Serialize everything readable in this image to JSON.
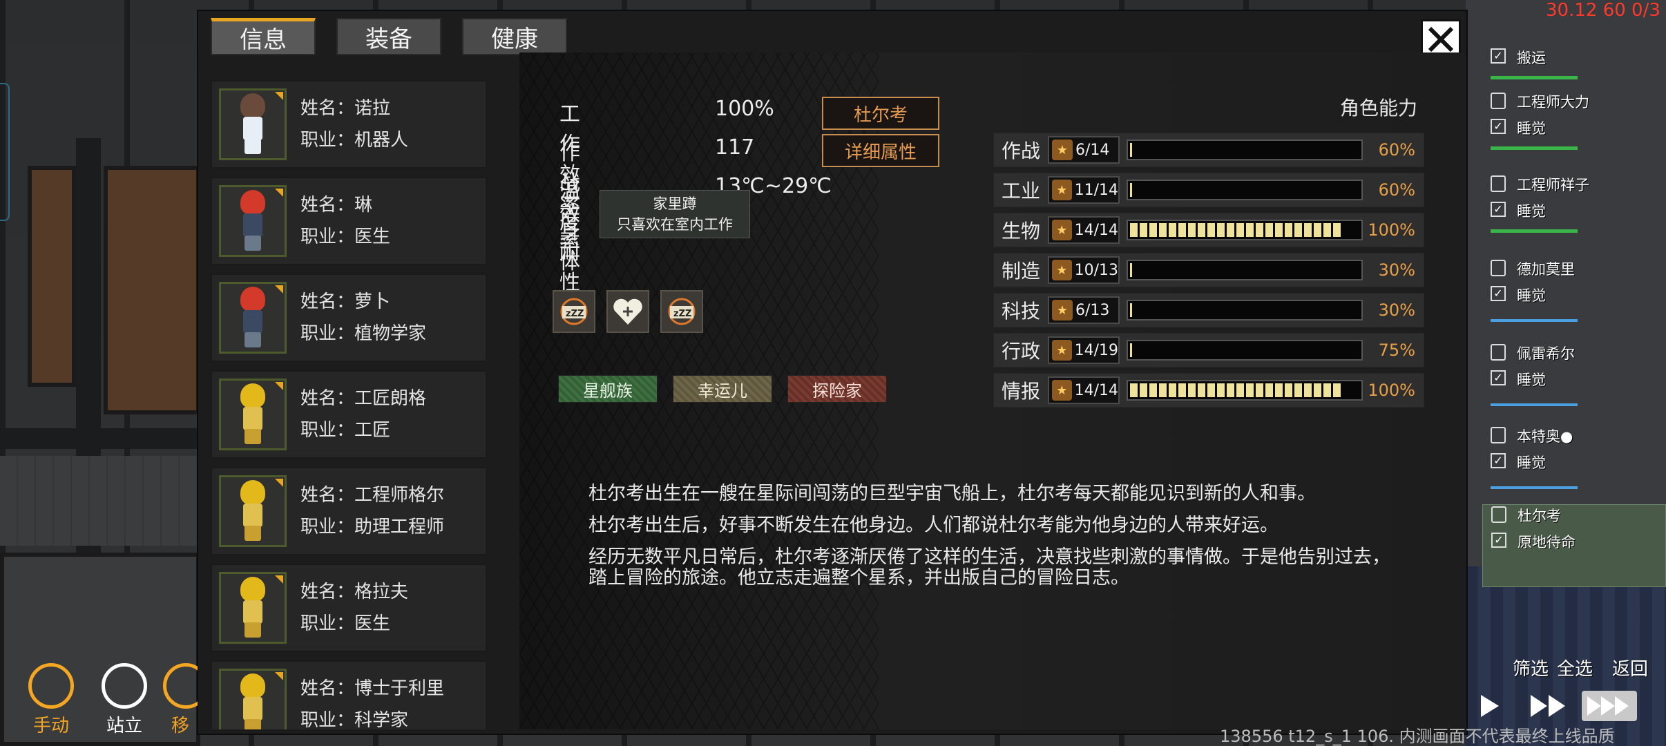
{
  "tabs": [
    {
      "label": "信息"
    },
    {
      "label": "装备"
    },
    {
      "label": "健康"
    }
  ],
  "roster": [
    {
      "name": "姓名：诺拉",
      "job": "职业：机器人",
      "head": "#6a4a3a",
      "body": "#e8eef5",
      "legs": "#e8eef5"
    },
    {
      "name": "姓名：琳",
      "job": "职业：医生",
      "head": "#d33a2a",
      "body": "#3b4a62",
      "legs": "#6a7a8a"
    },
    {
      "name": "姓名：萝卜",
      "job": "职业：植物学家",
      "head": "#d33a2a",
      "body": "#3b4a62",
      "legs": "#6a7a8a"
    },
    {
      "name": "姓名：工匠朗格",
      "job": "职业：工匠",
      "head": "#e2b81a",
      "body": "#e0c050",
      "legs": "#c8a030"
    },
    {
      "name": "姓名：工程师格尔",
      "job": "职业：助理工程师",
      "head": "#e2b81a",
      "body": "#e0c050",
      "legs": "#c8a030"
    },
    {
      "name": "姓名：格拉夫",
      "job": "职业：医生",
      "head": "#e2b81a",
      "body": "#e0c050",
      "legs": "#c8a030"
    },
    {
      "name": "姓名：博士于利里",
      "job": "职业：科学家",
      "head": "#e2b81a",
      "body": "#e0c050",
      "legs": "#c8a030"
    }
  ],
  "stats": {
    "work_eff_label": "工作效率",
    "work_eff_value": "100%",
    "combat_eff_label": "作战效率",
    "combat_eff_value": "117",
    "temp_label": "温度耐性",
    "temp_value": "13℃~29℃",
    "body_label": "身体"
  },
  "buttons": {
    "name_btn": "杜尔考",
    "detail_btn": "详细属性"
  },
  "tooltip": {
    "title": "家里蹲",
    "desc": "只喜欢在室内工作"
  },
  "status_icons": [
    {
      "icon": "sleep-icon"
    },
    {
      "icon": "heart-plus-icon"
    },
    {
      "icon": "sleep-icon"
    }
  ],
  "traits": [
    {
      "label": "星舰族",
      "color": "#3d7240"
    },
    {
      "label": "幸运儿",
      "color": "#6f6547"
    },
    {
      "label": "探险家",
      "color": "#7a3a2e"
    }
  ],
  "abilities_title": "角色能力",
  "abilities": [
    {
      "label": "作战",
      "value": "6/14",
      "pct": "60%",
      "segments": 0,
      "icon": "arm-icon"
    },
    {
      "label": "工业",
      "value": "11/14",
      "pct": "60%",
      "segments": 0,
      "icon": "book-icon"
    },
    {
      "label": "生物",
      "value": "14/14",
      "pct": "100%",
      "segments": 22,
      "icon": "paw-icon"
    },
    {
      "label": "制造",
      "value": "10/13",
      "pct": "30%",
      "segments": 0,
      "icon": "tools-icon"
    },
    {
      "label": "科技",
      "value": "6/13",
      "pct": "30%",
      "segments": 0,
      "icon": "feather-icon"
    },
    {
      "label": "行政",
      "value": "14/19",
      "pct": "75%",
      "segments": 0,
      "icon": "fist-icon"
    },
    {
      "label": "情报",
      "value": "14/14",
      "pct": "100%",
      "segments": 22,
      "icon": "target-icon"
    }
  ],
  "bio": [
    "杜尔考出生在一艘在星际间闯荡的巨型宇宙飞船上，杜尔考每天都能见识到新的人和事。",
    "杜尔考出生后，好事不断发生在他身边。人们都说杜尔考能为他身边的人带来好运。",
    "经历无数平凡日常后，杜尔考逐渐厌倦了这样的生活，决意找些刺激的事情做。于是他告别过去，踏上冒险的旅途。他立志走遍整个星系，并出版自己的冒险日志。"
  ],
  "side_list": [
    {
      "name": "",
      "status": "搬运"
    },
    {
      "name": "工程师大力",
      "status": "睡觉"
    },
    {
      "name": "工程师祥子",
      "status": "睡觉"
    },
    {
      "name": "德加莫里",
      "status": "睡觉"
    },
    {
      "name": "佩雷希尔",
      "status": "睡觉"
    },
    {
      "name": "本特奥●",
      "status": "睡觉"
    },
    {
      "name": "杜尔考",
      "status": "原地待命"
    }
  ],
  "top_right": "30.12 60 0/3",
  "bottom_left": [
    {
      "label": "手动",
      "color": "#f5a623"
    },
    {
      "label": "站立",
      "color": "#ffffff"
    },
    {
      "label": "移",
      "color": "#f5a623"
    }
  ],
  "corner": {
    "select_all": "全选",
    "back": "返回",
    "filter": "筛选"
  },
  "footer": "138556 t12_s_1 106. 内测画面不代表最终上线品质"
}
